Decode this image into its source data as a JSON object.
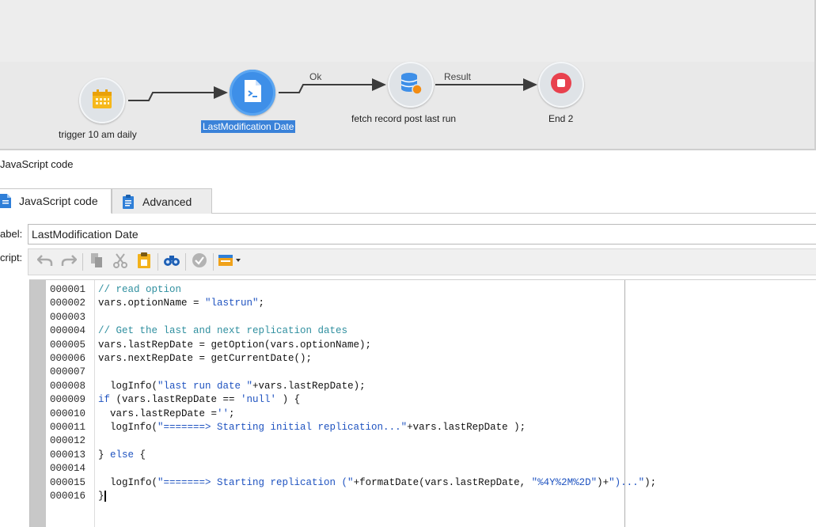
{
  "workflow": {
    "nodes": [
      {
        "id": "trigger",
        "label": "trigger 10 am daily",
        "icon": "calendar-icon",
        "selected": false
      },
      {
        "id": "js",
        "label": "LastModification Date",
        "icon": "script-file-icon",
        "selected": true
      },
      {
        "id": "fetch",
        "label": "fetch record post last run",
        "icon": "database-icon",
        "selected": false
      },
      {
        "id": "end",
        "label": "End 2",
        "icon": "stop-icon",
        "selected": false
      }
    ],
    "transitions": [
      {
        "from": "trigger",
        "to": "js",
        "label": ""
      },
      {
        "from": "js",
        "to": "fetch",
        "label": "Ok"
      },
      {
        "from": "fetch",
        "to": "end",
        "label": "Result"
      }
    ]
  },
  "panel": {
    "title": "JavaScript code",
    "tabs": [
      {
        "label": "JavaScript code",
        "icon": "document-icon",
        "active": true
      },
      {
        "label": "Advanced",
        "icon": "clipboard-icon",
        "active": false
      }
    ],
    "label_field": {
      "label": "abel:",
      "value": "LastModification Date"
    },
    "script_label": "cript:",
    "toolbar": [
      "undo-icon",
      "redo-icon",
      "copy-icon",
      "cut-icon",
      "paste-icon",
      "find-icon",
      "validate-icon",
      "insert-menu-icon"
    ]
  },
  "colors": {
    "accent_blue": "#3e8fe8",
    "selection": "#3a82d9",
    "comment": "#2f8f9f",
    "string": "#1f53c0",
    "stop_red": "#e8414e"
  },
  "code": {
    "lines": [
      {
        "num": "000001",
        "text": "// read option"
      },
      {
        "num": "000002",
        "text": "vars.optionName = \"lastrun\";"
      },
      {
        "num": "000003",
        "text": ""
      },
      {
        "num": "000004",
        "text": "// Get the last and next replication dates"
      },
      {
        "num": "000005",
        "text": "vars.lastRepDate = getOption(vars.optionName);"
      },
      {
        "num": "000006",
        "text": "vars.nextRepDate = getCurrentDate();"
      },
      {
        "num": "000007",
        "text": ""
      },
      {
        "num": "000008",
        "text": "  logInfo(\"last run date \"+vars.lastRepDate);"
      },
      {
        "num": "000009",
        "text": "if (vars.lastRepDate == 'null' ) {"
      },
      {
        "num": "000010",
        "text": "  vars.lastRepDate ='';"
      },
      {
        "num": "000011",
        "text": "  logInfo(\"=======> Starting initial replication...\"+vars.lastRepDate );"
      },
      {
        "num": "000012",
        "text": ""
      },
      {
        "num": "000013",
        "text": "} else {"
      },
      {
        "num": "000014",
        "text": ""
      },
      {
        "num": "000015",
        "text": "  logInfo(\"=======> Starting replication (\"+formatDate(vars.lastRepDate, \"%4Y%2M%2D\")+\")...\");"
      },
      {
        "num": "000016",
        "text": "}"
      }
    ]
  }
}
